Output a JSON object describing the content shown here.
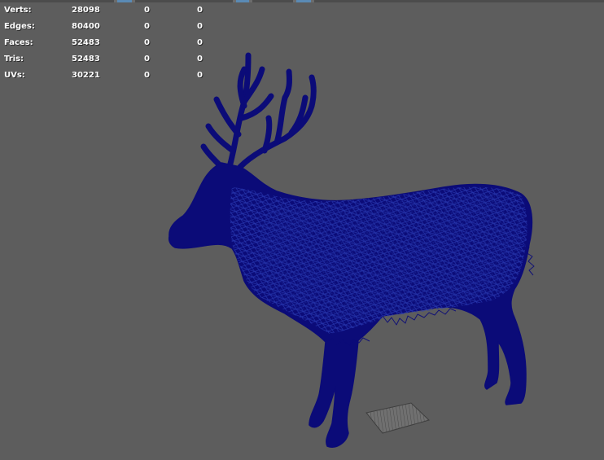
{
  "hud": {
    "rows": [
      {
        "label": "Verts:",
        "values": [
          "28098",
          "0",
          "0"
        ]
      },
      {
        "label": "Edges:",
        "values": [
          "80400",
          "0",
          "0"
        ]
      },
      {
        "label": "Faces:",
        "values": [
          "52483",
          "0",
          "0"
        ]
      },
      {
        "label": "Tris:",
        "values": [
          "52483",
          "0",
          "0"
        ]
      },
      {
        "label": "UVs:",
        "values": [
          "30221",
          "0",
          "0"
        ]
      }
    ]
  },
  "colors": {
    "viewport_bg": "#5d5d5d",
    "mesh_fill": "#0b0b78",
    "mesh_wire": "#1f2fa8",
    "plane": "#6e6e6e"
  }
}
